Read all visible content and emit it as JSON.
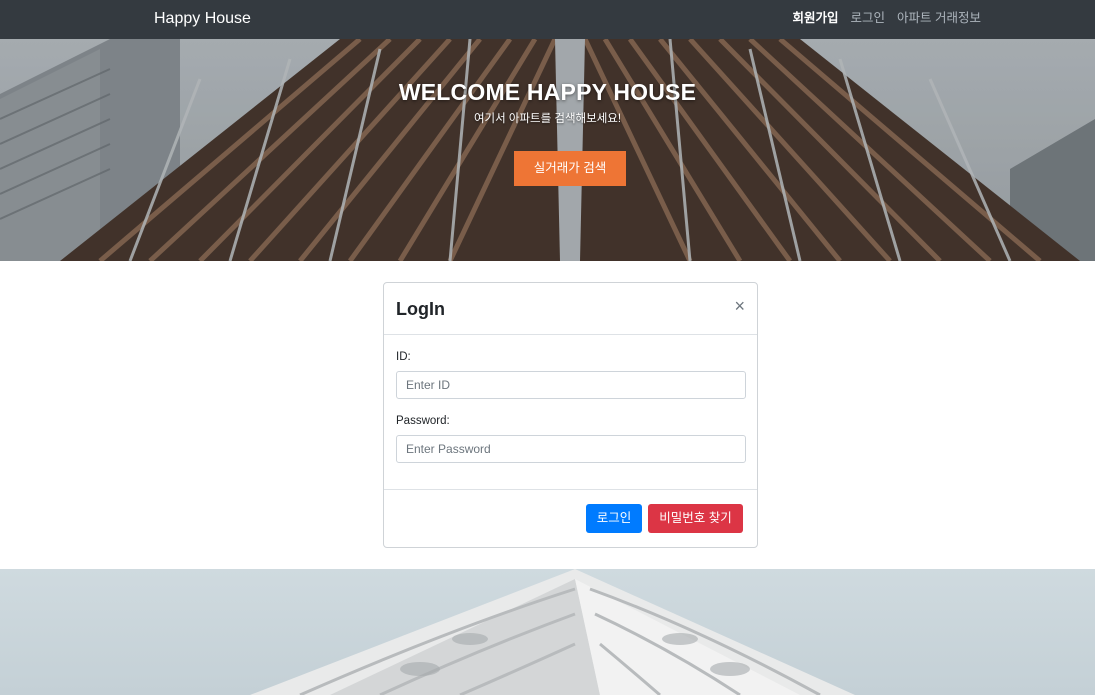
{
  "navbar": {
    "brand": "Happy House",
    "links": [
      {
        "label": "회원가입",
        "active": true
      },
      {
        "label": "로그인",
        "active": false
      },
      {
        "label": "아파트 거래정보",
        "active": false
      }
    ]
  },
  "hero": {
    "title": "WELCOME HAPPY HOUSE",
    "subtitle": "여기서 아파트를 검색해보세요!",
    "button": "실거래가 검색",
    "button_color": "#ee7535"
  },
  "login_modal": {
    "title": "LogIn",
    "close": "×",
    "id_label": "ID:",
    "id_placeholder": "Enter ID",
    "password_label": "Password:",
    "password_placeholder": "Enter Password",
    "login_button": "로그인",
    "find_password_button": "비밀번호 찾기"
  },
  "colors": {
    "navbar": "#343a40",
    "primary": "#007bff",
    "danger": "#dc3545"
  }
}
